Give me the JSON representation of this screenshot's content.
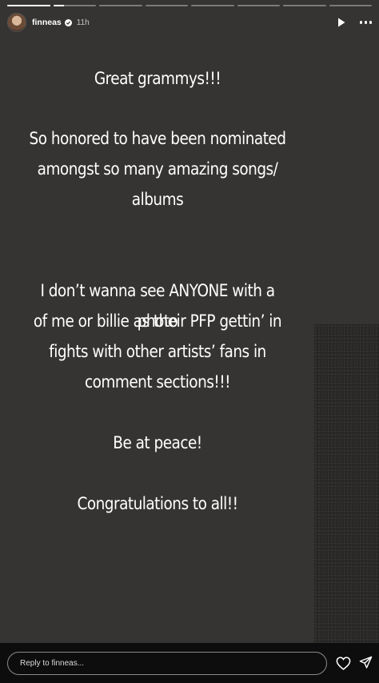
{
  "progress": [
    {
      "fill": 1.0
    },
    {
      "fill": 0.25
    },
    {
      "fill": 0
    },
    {
      "fill": 0
    },
    {
      "fill": 0
    },
    {
      "fill": 0
    },
    {
      "fill": 0
    },
    {
      "fill": 0
    }
  ],
  "header": {
    "username": "finneas",
    "time": "11h"
  },
  "story": {
    "lines": [
      "Great grammys!!!",
      "So honored to have been nominated",
      "amongst so many amazing songs/",
      "albums",
      "I don’t wanna see ANYONE with a photo",
      "of me or billie as their PFP gettin’ in",
      "fights with other artists’ fans in",
      "comment sections!!!",
      "Be at peace!",
      "Congratulations to all!!"
    ]
  },
  "footer": {
    "reply_placeholder": "Reply to finneas..."
  }
}
